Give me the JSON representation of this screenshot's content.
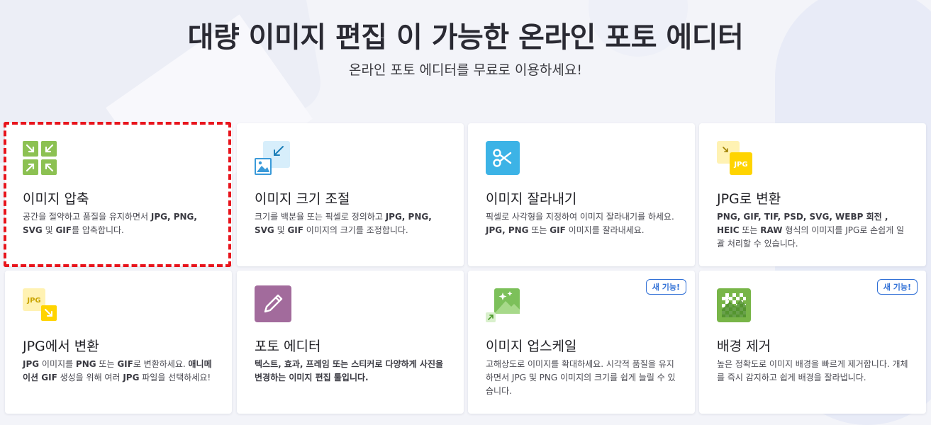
{
  "header": {
    "title": "대량 이미지 편집 이 가능한 온라인 포토 에디터",
    "subtitle": "온라인 포토 에디터를 무료로 이용하세요!"
  },
  "cards": [
    {
      "title": "이미지 압축",
      "icon": "compress-icon",
      "desc": [
        "공간을 절약하고 품질을 유지하면서 ",
        {
          "b": "JPG, PNG, SVG"
        },
        " 및 ",
        {
          "b": "GIF"
        },
        "를 압축합니다."
      ]
    },
    {
      "title": "이미지 크기 조절",
      "icon": "resize-icon",
      "desc": [
        "크기를 백분율 또는 픽셀로 정의하고 ",
        {
          "b": "JPG, PNG, SVG"
        },
        " 및 ",
        {
          "b": "GIF"
        },
        " 이미지의 크기를 조정합니다."
      ]
    },
    {
      "title": "이미지 잘라내기",
      "icon": "scissors-icon",
      "desc": [
        "픽셀로 사각형을 지정하여 이미지 잘라내기를 하세요. ",
        {
          "b": "JPG, PNG"
        },
        " 또는 ",
        {
          "b": "GIF"
        },
        " 이미지를 잘라내세요."
      ]
    },
    {
      "title": "JPG로 변환",
      "icon": "convert-to-jpg-icon",
      "icon_text": "JPG",
      "desc": [
        {
          "b": "PNG, GIF, TIF, PSD, SVG, WEBP 회전 , HEIC"
        },
        " 또는 ",
        {
          "b": "RAW"
        },
        " 형식의 이미지를 JPG로 손쉽게 일괄 처리할 수 있습니다."
      ]
    },
    {
      "title": "JPG에서 변환",
      "icon": "convert-from-jpg-icon",
      "icon_text": "JPG",
      "desc": [
        {
          "b": "JPG"
        },
        " 이미지를 ",
        {
          "b": "PNG"
        },
        " 또는 ",
        {
          "b": "GIF"
        },
        "로 변환하세요. ",
        {
          "b": "애니메이션 GIF"
        },
        " 생성을 위해 여러 ",
        {
          "b": "JPG"
        },
        " 파일을 선택하세요!"
      ]
    },
    {
      "title": "포토 에디터",
      "icon": "pencil-icon",
      "desc": [
        {
          "b": "텍스트, 효과, 프레임 또는 스티커로 다양하게 사진을 변경하는 이미지 편집 툴입니다."
        }
      ]
    },
    {
      "title": "이미지 업스케일",
      "icon": "upscale-icon",
      "badge": "새 기능!",
      "desc": [
        "고해상도로 이미지를 확대하세요. 시각적 품질을 유지하면서 JPG 및 PNG 이미지의 크기를 쉽게 늘릴 수 있습니다."
      ]
    },
    {
      "title": "배경 제거",
      "icon": "remove-background-icon",
      "badge": "새 기능!",
      "desc": [
        "높은 정확도로 이미지 배경을 빠르게 제거합니다. 개체를 즉시 감지하고 쉽게 배경을 잘라냅니다."
      ]
    }
  ],
  "colors": {
    "compress": "#8cc152",
    "resize": "#d7eefb",
    "scissors": "#3cb3e6",
    "jpg": "#ffd400",
    "pencil": "#a26b9c",
    "upscale": "#7cc05a",
    "remove_bg": "#78b548",
    "highlight": "#e8141c",
    "badge": "#2f6fd6"
  }
}
